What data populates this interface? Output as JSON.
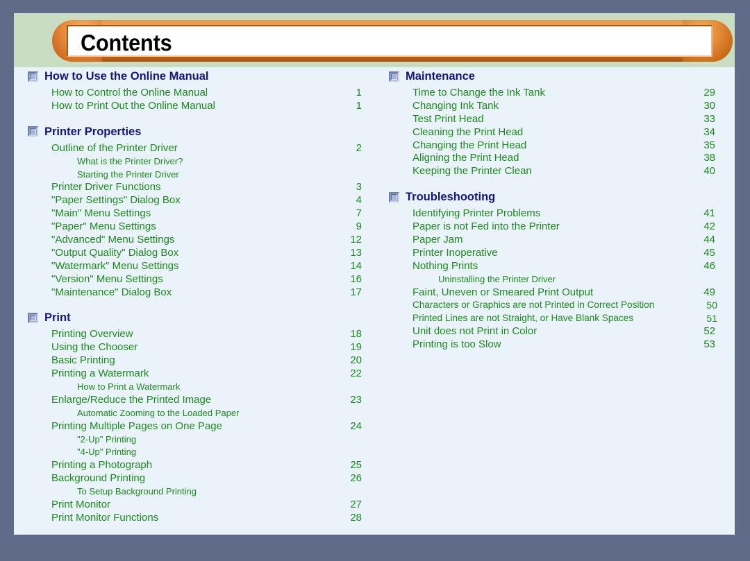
{
  "banner": {
    "title": "Contents"
  },
  "colors": {
    "outer_background": "#5f6b89",
    "page_background": "#eaf2fa",
    "banner_band": "#c9ddc2",
    "capsule_orange": "#e9873a",
    "heading_navy": "#151580",
    "entry_green": "#1c8a1c"
  },
  "columns": {
    "left": [
      {
        "title": "How to Use the Online Manual",
        "entries": [
          {
            "label": "How to Control the Online Manual",
            "page": "1",
            "level": 1
          },
          {
            "label": "How to Print Out the Online Manual",
            "page": "1",
            "level": 1
          }
        ]
      },
      {
        "title": "Printer Properties",
        "entries": [
          {
            "label": "Outline of the Printer Driver",
            "page": "2",
            "level": 1
          },
          {
            "label": "What is the Printer Driver?",
            "page": "",
            "level": 2
          },
          {
            "label": "Starting the Printer Driver",
            "page": "",
            "level": 2
          },
          {
            "label": "Printer Driver Functions",
            "page": "3",
            "level": 1
          },
          {
            "label": "\"Paper Settings\" Dialog Box",
            "page": "4",
            "level": 1
          },
          {
            "label": "\"Main\" Menu Settings",
            "page": "7",
            "level": 1
          },
          {
            "label": "\"Paper\" Menu Settings",
            "page": "9",
            "level": 1
          },
          {
            "label": "\"Advanced\" Menu Settings",
            "page": "12",
            "level": 1
          },
          {
            "label": "\"Output Quality\" Dialog Box",
            "page": "13",
            "level": 1
          },
          {
            "label": "\"Watermark\" Menu Settings",
            "page": "14",
            "level": 1
          },
          {
            "label": "\"Version\" Menu Settings",
            "page": "16",
            "level": 1
          },
          {
            "label": "\"Maintenance\" Dialog Box",
            "page": "17",
            "level": 1
          }
        ]
      },
      {
        "title": "Print",
        "entries": [
          {
            "label": "Printing Overview",
            "page": "18",
            "level": 1
          },
          {
            "label": "Using the Chooser",
            "page": "19",
            "level": 1
          },
          {
            "label": "Basic Printing",
            "page": "20",
            "level": 1
          },
          {
            "label": "Printing a Watermark",
            "page": "22",
            "level": 1
          },
          {
            "label": "How to Print a Watermark",
            "page": "",
            "level": 2
          },
          {
            "label": "Enlarge/Reduce the Printed Image",
            "page": "23",
            "level": 1
          },
          {
            "label": "Automatic Zooming to the Loaded Paper",
            "page": "",
            "level": 2
          },
          {
            "label": "Printing Multiple Pages on One Page",
            "page": "24",
            "level": 1
          },
          {
            "label": "\"2-Up\" Printing",
            "page": "",
            "level": 2
          },
          {
            "label": "\"4-Up\" Printing",
            "page": "",
            "level": 2
          },
          {
            "label": "Printing a Photograph",
            "page": "25",
            "level": 1
          },
          {
            "label": "Background Printing",
            "page": "26",
            "level": 1
          },
          {
            "label": "To Setup Background Printing",
            "page": "",
            "level": 2
          },
          {
            "label": "Print Monitor",
            "page": "27",
            "level": 1
          },
          {
            "label": "Print Monitor Functions",
            "page": "28",
            "level": 1
          }
        ]
      }
    ],
    "right": [
      {
        "title": "Maintenance",
        "entries": [
          {
            "label": "Time to Change the Ink Tank",
            "page": "29",
            "level": 1
          },
          {
            "label": "Changing Ink Tank",
            "page": "30",
            "level": 1
          },
          {
            "label": "Test Print Head",
            "page": "33",
            "level": 1
          },
          {
            "label": "Cleaning the Print Head",
            "page": "34",
            "level": 1
          },
          {
            "label": "Changing the Print Head",
            "page": "35",
            "level": 1
          },
          {
            "label": "Aligning the Print Head",
            "page": "38",
            "level": 1
          },
          {
            "label": "Keeping the Printer Clean",
            "page": "40",
            "level": 1
          }
        ]
      },
      {
        "title": "Troubleshooting",
        "entries": [
          {
            "label": "Identifying Printer Problems",
            "page": "41",
            "level": 1
          },
          {
            "label": "Paper is not Fed into the Printer",
            "page": "42",
            "level": 1
          },
          {
            "label": "Paper Jam",
            "page": "44",
            "level": 1
          },
          {
            "label": "Printer Inoperative",
            "page": "45",
            "level": 1
          },
          {
            "label": "Nothing Prints",
            "page": "46",
            "level": 1
          },
          {
            "label": "Uninstalling the Printer Driver",
            "page": "",
            "level": 2
          },
          {
            "label": "Faint, Uneven or Smeared Print Output",
            "page": "49",
            "level": 1
          },
          {
            "label": "Characters or Graphics are not Printed in Correct Position",
            "page": "50",
            "level": 1,
            "tight": true
          },
          {
            "label": "Printed Lines are not Straight, or Have Blank Spaces",
            "page": "51",
            "level": 1,
            "tight": true
          },
          {
            "label": "Unit does not Print in Color",
            "page": "52",
            "level": 1
          },
          {
            "label": "Printing is too Slow",
            "page": "53",
            "level": 1
          }
        ]
      }
    ]
  }
}
